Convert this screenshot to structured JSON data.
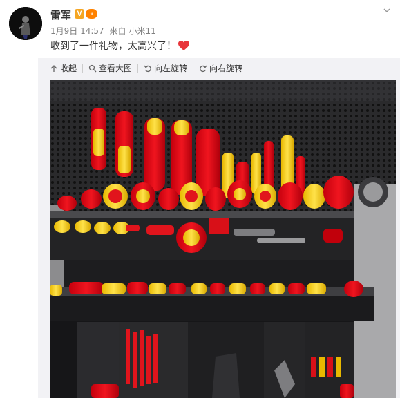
{
  "post": {
    "author": "雷军",
    "verified_badge": "V",
    "level_badge": "⁶",
    "date": "1月9日 14:57",
    "source_prefix": "来自",
    "source_device": "小米11",
    "text": "收到了一件礼物，太高兴了！"
  },
  "toolbar": {
    "collapse": "收起",
    "view_large": "查看大图",
    "rotate_left": "向左旋转",
    "rotate_right": "向右旋转"
  },
  "colors": {
    "accent_orange": "#ff8200",
    "heart_red": "#e8353b",
    "tool_red": "#e30613",
    "tool_yellow": "#ffd400"
  },
  "icons": [
    "chevron-down-icon",
    "collapse-arrow-icon",
    "zoom-icon",
    "rotate-left-icon",
    "rotate-right-icon",
    "heart-icon"
  ]
}
